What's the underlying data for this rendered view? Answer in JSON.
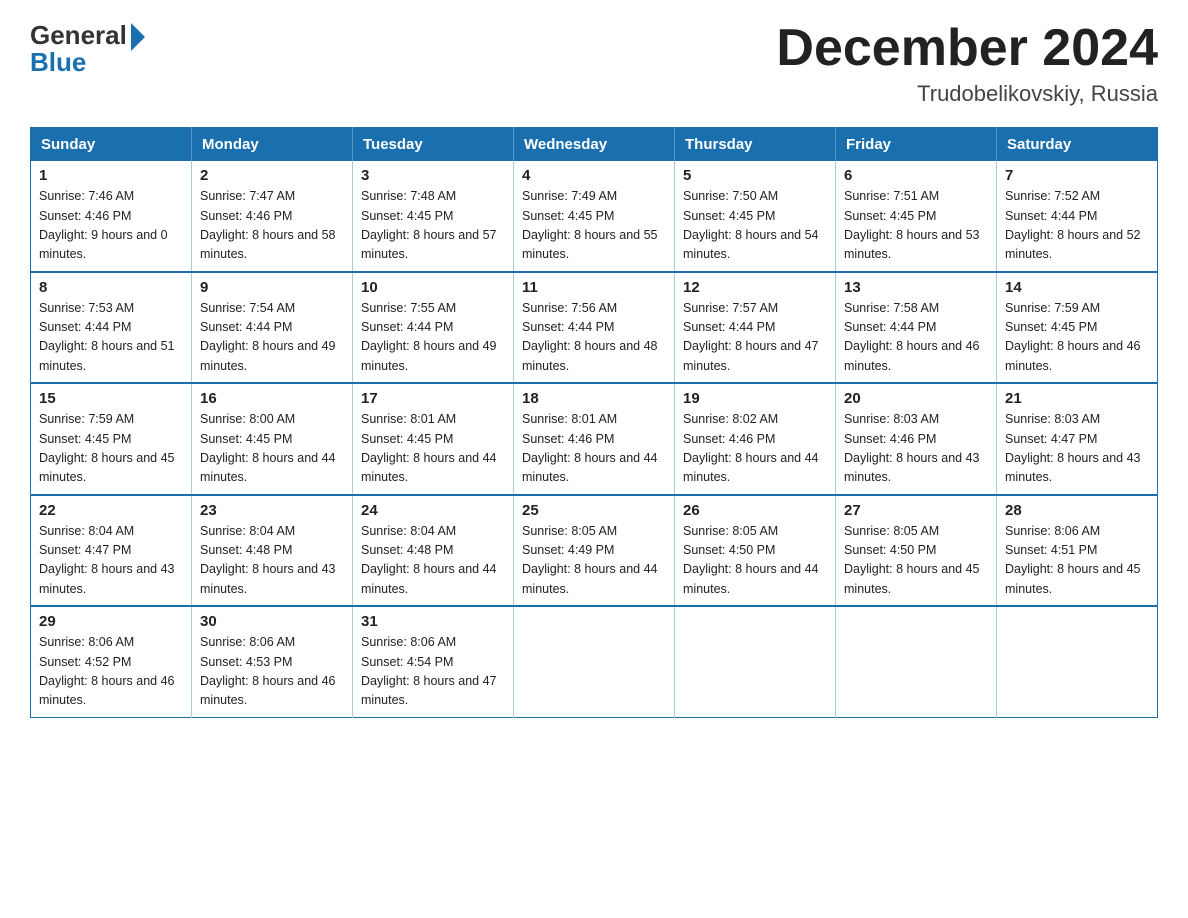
{
  "header": {
    "logo_general": "General",
    "logo_blue": "Blue",
    "month_year": "December 2024",
    "location": "Trudobelikovskiy, Russia"
  },
  "days_of_week": [
    "Sunday",
    "Monday",
    "Tuesday",
    "Wednesday",
    "Thursday",
    "Friday",
    "Saturday"
  ],
  "weeks": [
    [
      {
        "day": "1",
        "sunrise": "7:46 AM",
        "sunset": "4:46 PM",
        "daylight": "9 hours and 0 minutes."
      },
      {
        "day": "2",
        "sunrise": "7:47 AM",
        "sunset": "4:46 PM",
        "daylight": "8 hours and 58 minutes."
      },
      {
        "day": "3",
        "sunrise": "7:48 AM",
        "sunset": "4:45 PM",
        "daylight": "8 hours and 57 minutes."
      },
      {
        "day": "4",
        "sunrise": "7:49 AM",
        "sunset": "4:45 PM",
        "daylight": "8 hours and 55 minutes."
      },
      {
        "day": "5",
        "sunrise": "7:50 AM",
        "sunset": "4:45 PM",
        "daylight": "8 hours and 54 minutes."
      },
      {
        "day": "6",
        "sunrise": "7:51 AM",
        "sunset": "4:45 PM",
        "daylight": "8 hours and 53 minutes."
      },
      {
        "day": "7",
        "sunrise": "7:52 AM",
        "sunset": "4:44 PM",
        "daylight": "8 hours and 52 minutes."
      }
    ],
    [
      {
        "day": "8",
        "sunrise": "7:53 AM",
        "sunset": "4:44 PM",
        "daylight": "8 hours and 51 minutes."
      },
      {
        "day": "9",
        "sunrise": "7:54 AM",
        "sunset": "4:44 PM",
        "daylight": "8 hours and 49 minutes."
      },
      {
        "day": "10",
        "sunrise": "7:55 AM",
        "sunset": "4:44 PM",
        "daylight": "8 hours and 49 minutes."
      },
      {
        "day": "11",
        "sunrise": "7:56 AM",
        "sunset": "4:44 PM",
        "daylight": "8 hours and 48 minutes."
      },
      {
        "day": "12",
        "sunrise": "7:57 AM",
        "sunset": "4:44 PM",
        "daylight": "8 hours and 47 minutes."
      },
      {
        "day": "13",
        "sunrise": "7:58 AM",
        "sunset": "4:44 PM",
        "daylight": "8 hours and 46 minutes."
      },
      {
        "day": "14",
        "sunrise": "7:59 AM",
        "sunset": "4:45 PM",
        "daylight": "8 hours and 46 minutes."
      }
    ],
    [
      {
        "day": "15",
        "sunrise": "7:59 AM",
        "sunset": "4:45 PM",
        "daylight": "8 hours and 45 minutes."
      },
      {
        "day": "16",
        "sunrise": "8:00 AM",
        "sunset": "4:45 PM",
        "daylight": "8 hours and 44 minutes."
      },
      {
        "day": "17",
        "sunrise": "8:01 AM",
        "sunset": "4:45 PM",
        "daylight": "8 hours and 44 minutes."
      },
      {
        "day": "18",
        "sunrise": "8:01 AM",
        "sunset": "4:46 PM",
        "daylight": "8 hours and 44 minutes."
      },
      {
        "day": "19",
        "sunrise": "8:02 AM",
        "sunset": "4:46 PM",
        "daylight": "8 hours and 44 minutes."
      },
      {
        "day": "20",
        "sunrise": "8:03 AM",
        "sunset": "4:46 PM",
        "daylight": "8 hours and 43 minutes."
      },
      {
        "day": "21",
        "sunrise": "8:03 AM",
        "sunset": "4:47 PM",
        "daylight": "8 hours and 43 minutes."
      }
    ],
    [
      {
        "day": "22",
        "sunrise": "8:04 AM",
        "sunset": "4:47 PM",
        "daylight": "8 hours and 43 minutes."
      },
      {
        "day": "23",
        "sunrise": "8:04 AM",
        "sunset": "4:48 PM",
        "daylight": "8 hours and 43 minutes."
      },
      {
        "day": "24",
        "sunrise": "8:04 AM",
        "sunset": "4:48 PM",
        "daylight": "8 hours and 44 minutes."
      },
      {
        "day": "25",
        "sunrise": "8:05 AM",
        "sunset": "4:49 PM",
        "daylight": "8 hours and 44 minutes."
      },
      {
        "day": "26",
        "sunrise": "8:05 AM",
        "sunset": "4:50 PM",
        "daylight": "8 hours and 44 minutes."
      },
      {
        "day": "27",
        "sunrise": "8:05 AM",
        "sunset": "4:50 PM",
        "daylight": "8 hours and 45 minutes."
      },
      {
        "day": "28",
        "sunrise": "8:06 AM",
        "sunset": "4:51 PM",
        "daylight": "8 hours and 45 minutes."
      }
    ],
    [
      {
        "day": "29",
        "sunrise": "8:06 AM",
        "sunset": "4:52 PM",
        "daylight": "8 hours and 46 minutes."
      },
      {
        "day": "30",
        "sunrise": "8:06 AM",
        "sunset": "4:53 PM",
        "daylight": "8 hours and 46 minutes."
      },
      {
        "day": "31",
        "sunrise": "8:06 AM",
        "sunset": "4:54 PM",
        "daylight": "8 hours and 47 minutes."
      },
      null,
      null,
      null,
      null
    ]
  ]
}
